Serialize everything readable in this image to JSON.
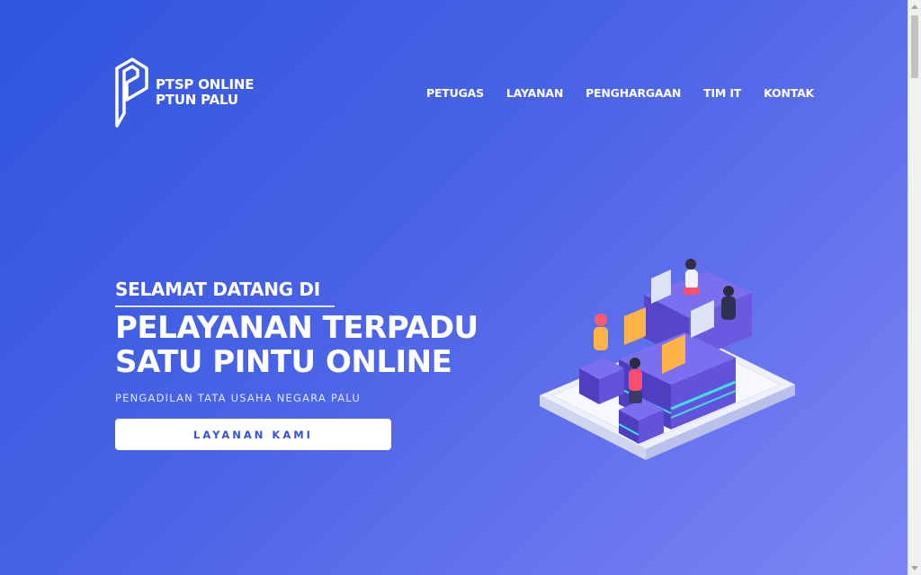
{
  "logo": {
    "line1": "PTSP ONLINE",
    "line2": "PTUN PALU",
    "icon": "p-logo-icon"
  },
  "nav": {
    "items": [
      "PETUGAS",
      "LAYANAN",
      "PENGHARGAAN",
      "TIM IT",
      "KONTAK"
    ]
  },
  "hero": {
    "welcome": "SELAMAT DATANG DI",
    "headline_line1": "PELAYANAN TERPADU",
    "headline_line2": "SATU PINTU ONLINE",
    "subtitle": "PENGADILAN TATA USAHA NEGARA PALU",
    "cta": "LAYANAN KAMI"
  },
  "colors": {
    "gradient_start": "#2f55de",
    "gradient_end": "#7d86f3",
    "cta_text": "#3551d8"
  }
}
